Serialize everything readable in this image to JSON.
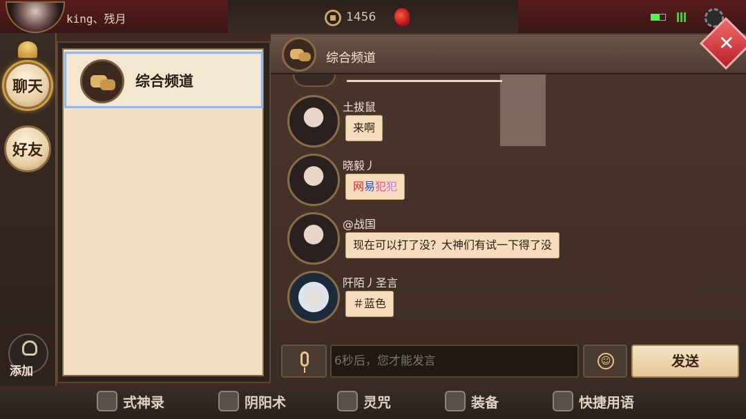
{
  "topbar": {
    "player_name": "king、残月",
    "coin_count": "1456"
  },
  "left_rail": {
    "chat_label": "聊天",
    "friends_label": "好友",
    "add_label": "添加"
  },
  "channels": [
    {
      "label": "综合频道",
      "selected": true
    }
  ],
  "chat": {
    "title": "综合频道",
    "messages": [
      {
        "sender": "土拔鼠",
        "text": "来啊"
      },
      {
        "sender": "晓毅丿",
        "text_parts": [
          "网",
          "易",
          "犯",
          "犯"
        ]
      },
      {
        "sender": "@战国",
        "text": "现在可以打了没？大神们有试一下得了没"
      },
      {
        "sender": "阡陌丿圣言",
        "text": "＃蓝色"
      }
    ],
    "input_placeholder": "6秒后，您才能发言",
    "send_label": "发送"
  },
  "bottom_nav": {
    "items": [
      {
        "label": "式神录"
      },
      {
        "label": "阴阳术"
      },
      {
        "label": "灵咒"
      },
      {
        "label": "装备"
      },
      {
        "label": "快捷用语"
      }
    ]
  },
  "icons": {
    "coin": "coin-icon",
    "jade": "jade-icon",
    "settings": "gear-icon",
    "close": "close-icon",
    "mic": "microphone-icon",
    "emoji": "emoji-icon",
    "channel": "chat-bubbles-icon"
  }
}
